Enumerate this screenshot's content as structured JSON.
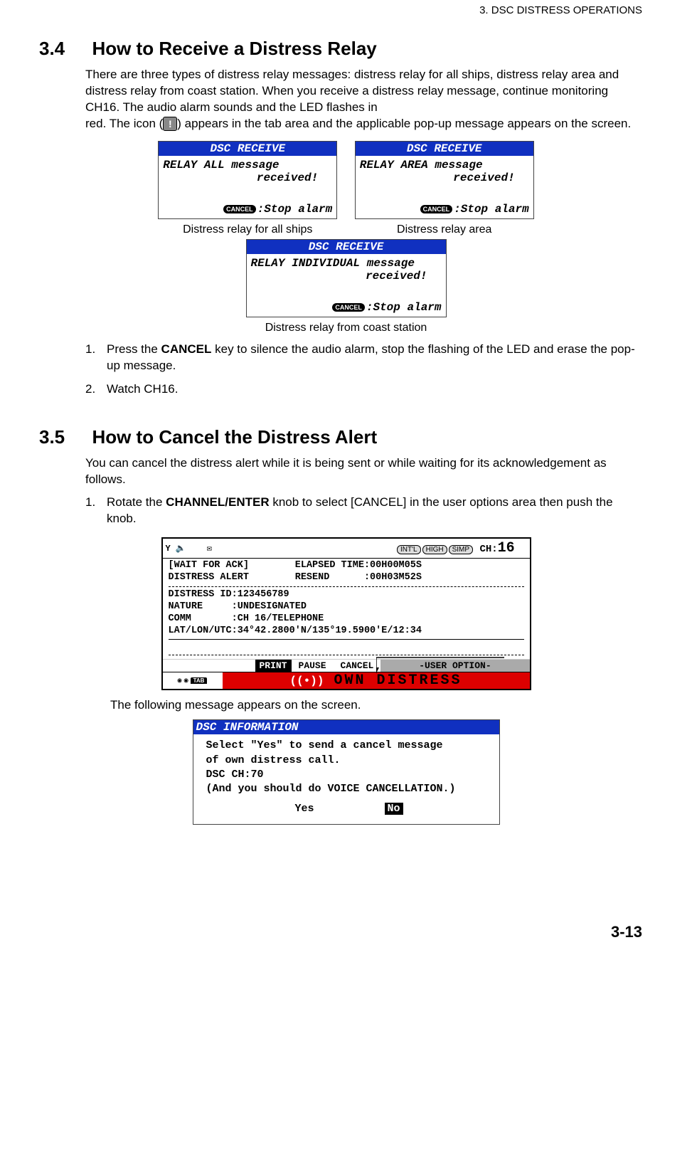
{
  "header": "3.  DSC DISTRESS OPERATIONS",
  "sec34": {
    "num": "3.4",
    "title": "How to Receive a Distress Relay",
    "para1": "There are three types of distress relay messages: distress relay for all ships, distress relay area and distress relay from coast station. When you receive a distress relay message, continue monitoring CH16. The audio alarm sounds and the LED flashes in",
    "para2a": "red. The icon (",
    "para2b": ") appears in the tab area and the applicable pop-up message appears on the screen."
  },
  "dsc_title": "DSC RECEIVE",
  "cancel_pill": "CANCEL",
  "stop_alarm": ":Stop alarm",
  "dlg1": {
    "l1": "RELAY ALL message",
    "l2": "received!",
    "cap": "Distress relay for all ships"
  },
  "dlg2": {
    "l1": "RELAY AREA message",
    "l2": "received!",
    "cap": "Distress relay area"
  },
  "dlg3": {
    "l1": "RELAY INDIVIDUAL message",
    "l2": "received!",
    "cap": "Distress relay from coast station"
  },
  "steps34": {
    "s1n": "1.",
    "s1a": "Press the ",
    "s1b": "CANCEL",
    "s1c": " key to silence the audio alarm, stop the flashing of the LED and erase the pop-up message.",
    "s2n": "2.",
    "s2": "Watch CH16."
  },
  "sec35": {
    "num": "3.5",
    "title": "How to Cancel the Distress Alert",
    "para": "You can cancel the distress alert while it is being sent or while waiting for its acknowledgement as follows.",
    "s1n": "1.",
    "s1a": "Rotate the ",
    "s1b": "CHANNEL/ENTER",
    "s1c": " knob to select [CANCEL] in the user options area then push the knob."
  },
  "screen": {
    "badges": {
      "intl": "INT'L",
      "high": "HIGH",
      "simp": "SIMP"
    },
    "ch_label": "CH:",
    "ch_val": "16",
    "l1": "[WAIT FOR ACK]        ELAPSED TIME:00H00M05S",
    "l2": "DISTRESS ALERT        RESEND      :00H03M52S",
    "l3": "DISTRESS ID:123456789",
    "l4": "NATURE     :UNDESIGNATED",
    "l5": "COMM       :CH 16/TELEPHONE",
    "l6": "LAT/LON/UTC:34°42.2800'N/135°19.5900'E/12:34",
    "opt_print": "PRINT",
    "opt_pause": "PAUSE",
    "opt_cancel": "CANCEL",
    "opt_user": "-USER OPTION-",
    "tab": "TAB",
    "own": "OWN DISTRESS"
  },
  "after_screen": "The following message appears on the screen.",
  "info": {
    "title": "DSC INFORMATION",
    "l1": "Select \"Yes\" to send a cancel message",
    "l2": "of own distress call.",
    "l3": "DSC CH:70",
    "l4": "(And you should do VOICE CANCELLATION.)",
    "yes": "Yes",
    "no": "No"
  },
  "page_num": "3-13"
}
